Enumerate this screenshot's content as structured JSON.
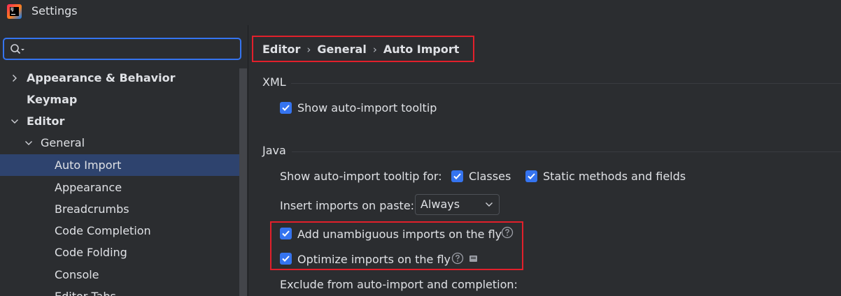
{
  "window": {
    "title": "Settings",
    "logo_text": "IJ"
  },
  "search": {
    "value": "",
    "placeholder": ""
  },
  "tree": {
    "items": [
      {
        "label": "Appearance & Behavior",
        "expanded": false,
        "selected": false
      },
      {
        "label": "Keymap"
      },
      {
        "label": "Editor",
        "expanded": true
      },
      {
        "label": "General",
        "expanded": true
      },
      {
        "label": "Auto Import",
        "selected": true
      },
      {
        "label": "Appearance"
      },
      {
        "label": "Breadcrumbs"
      },
      {
        "label": "Code Completion"
      },
      {
        "label": "Code Folding"
      },
      {
        "label": "Console"
      },
      {
        "label": "Editor Tabs"
      }
    ]
  },
  "breadcrumb": {
    "items": [
      "Editor",
      "General",
      "Auto Import"
    ],
    "separator": "›"
  },
  "xml": {
    "section_title": "XML",
    "show_tooltip": {
      "label": "Show auto-import tooltip",
      "checked": true
    }
  },
  "java": {
    "section_title": "Java",
    "tooltip_for_label": "Show auto-import tooltip for:",
    "classes": {
      "label": "Classes",
      "checked": true
    },
    "static_methods": {
      "label": "Static methods and fields",
      "checked": true
    },
    "insert_on_paste_label": "Insert imports on paste:",
    "insert_on_paste_value": "Always",
    "add_unambiguous": {
      "label": "Add unambiguous imports on the fly",
      "checked": true
    },
    "optimize_imports": {
      "label": "Optimize imports on the fly",
      "checked": true
    },
    "exclude_label": "Exclude from auto-import and completion:"
  },
  "colors": {
    "accent": "#3574f0",
    "highlight": "#e2202b",
    "selection": "#2e436e",
    "background": "#2b2d30"
  }
}
